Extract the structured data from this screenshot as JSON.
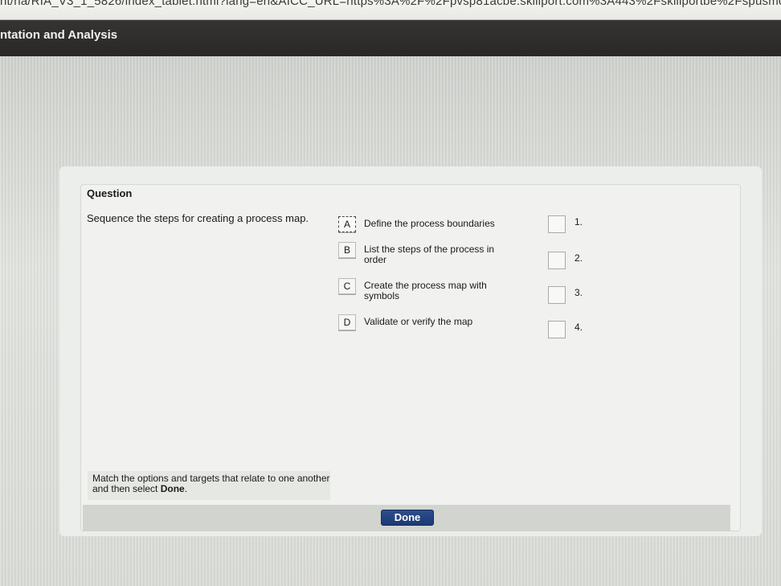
{
  "browser": {
    "url": "nt/na/RIA_V3_1_5826/index_tablet.html?lang=en&AICC_URL=https%3A%2F%2Fpvsp81acbe.skillport.com%3A443%2Fskillportbe%2Fspusmc%"
  },
  "header": {
    "title": "ntation and Analysis"
  },
  "question": {
    "heading": "Question",
    "text": "Sequence the steps for creating a process map."
  },
  "options": [
    {
      "letter": "A",
      "label": "Define the process boundaries"
    },
    {
      "letter": "B",
      "label": "List the steps of the process in order"
    },
    {
      "letter": "C",
      "label": "Create the process map with symbols"
    },
    {
      "letter": "D",
      "label": "Validate or verify the map"
    }
  ],
  "targets": [
    {
      "label": "1."
    },
    {
      "label": "2."
    },
    {
      "label": "3."
    },
    {
      "label": "4."
    }
  ],
  "instructions": {
    "text_before": "Match the options and targets that relate to one another and then select ",
    "text_bold": "Done",
    "text_after": "."
  },
  "actions": {
    "done_label": "Done"
  }
}
